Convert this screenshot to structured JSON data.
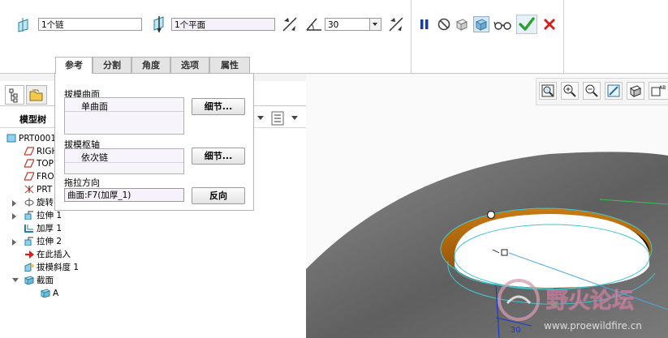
{
  "dashboard": {
    "surfaces_collector": "1个链",
    "hinge_collector": "1个平面",
    "angle_value": "30"
  },
  "tabs": [
    {
      "label": "参考"
    },
    {
      "label": "分割"
    },
    {
      "label": "角度"
    },
    {
      "label": "选项"
    },
    {
      "label": "属性"
    }
  ],
  "references_panel": {
    "draft_surfaces_label": "拔模曲面",
    "draft_surfaces_item": "单曲面",
    "draft_hinges_label": "拔模枢轴",
    "draft_hinges_item": "依次链",
    "details_button": "细节...",
    "pull_direction_label": "拖拉方向",
    "pull_direction_value": "曲面:F7(加厚_1)",
    "flip_button": "反向"
  },
  "model_tree": {
    "title": "模型树",
    "items": [
      {
        "label": "PRT0001",
        "visible": "PRT0001"
      },
      {
        "label": "RIGHT",
        "visible": "RIGH"
      },
      {
        "label": "TOP",
        "visible": "TOP"
      },
      {
        "label": "FRONT",
        "visible": "FRO"
      },
      {
        "label": "PRT_CSYS",
        "visible": "PRT"
      },
      {
        "label": "旋转",
        "visible": "旋转"
      },
      {
        "label": "拉伸 1"
      },
      {
        "label": "加厚 1"
      },
      {
        "label": "拉伸 2"
      },
      {
        "label": "在此插入"
      },
      {
        "label": "拔模斜度 1"
      },
      {
        "label": "截面"
      },
      {
        "label": "A"
      }
    ]
  },
  "graphics": {
    "dimension_label": "30",
    "watermark_text": "野火论坛",
    "watermark_url": "www.proewildfire.cn"
  },
  "colors": {
    "accept_green": "#27a32c",
    "cancel_red": "#d0211c",
    "model_gray": "#6f6f6f",
    "rim_orange": "#b86a0a",
    "highlight_cyan": "#3cc8d2"
  }
}
